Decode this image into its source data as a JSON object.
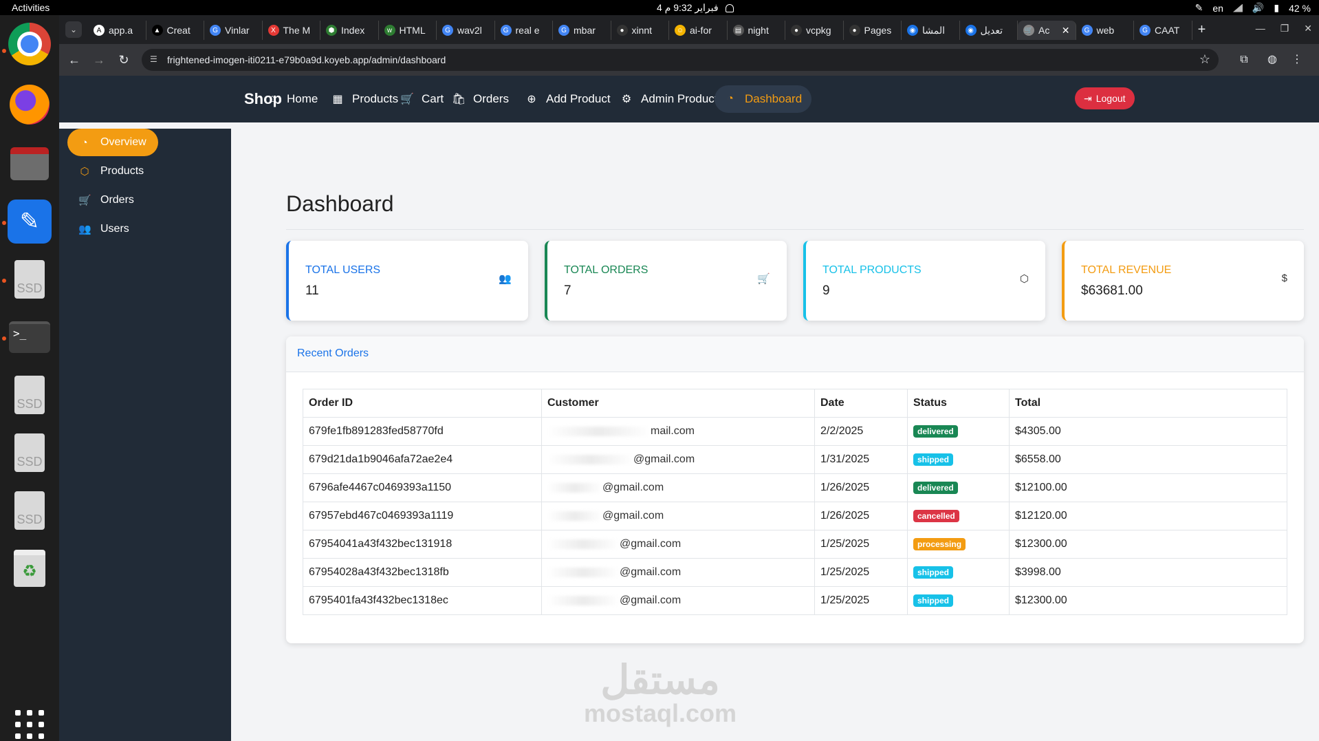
{
  "system": {
    "activities": "Activities",
    "clock": "4 فبراير  9:32 م",
    "lang": "en",
    "battery": "42 %"
  },
  "browser": {
    "tabs": [
      {
        "title": "app.a",
        "favicon_color": "#ffffff",
        "glyph": "A"
      },
      {
        "title": "Creat",
        "favicon_color": "#000000",
        "glyph": "▲"
      },
      {
        "title": "Vinlar",
        "favicon_color": "#4285f4",
        "glyph": "G"
      },
      {
        "title": "The M",
        "favicon_color": "#e53935",
        "glyph": "X"
      },
      {
        "title": "Index",
        "favicon_color": "#2e7d32",
        "glyph": "⬢"
      },
      {
        "title": "HTML",
        "favicon_color": "#2e7d32",
        "glyph": "w"
      },
      {
        "title": "wav2l",
        "favicon_color": "#4285f4",
        "glyph": "G"
      },
      {
        "title": "real e",
        "favicon_color": "#4285f4",
        "glyph": "G"
      },
      {
        "title": "mbar",
        "favicon_color": "#4285f4",
        "glyph": "G"
      },
      {
        "title": "xinnt",
        "favicon_color": "#333333",
        "glyph": "●"
      },
      {
        "title": "ai-for",
        "favicon_color": "#f4b400",
        "glyph": "☺"
      },
      {
        "title": "night",
        "favicon_color": "#555555",
        "glyph": "▤"
      },
      {
        "title": "vcpkg",
        "favicon_color": "#333333",
        "glyph": "●"
      },
      {
        "title": "Pages",
        "favicon_color": "#333333",
        "glyph": "●"
      },
      {
        "title": "المشا",
        "favicon_color": "#1a73e8",
        "glyph": "◉"
      },
      {
        "title": "تعديل",
        "favicon_color": "#1a73e8",
        "glyph": "◉"
      },
      {
        "title": "Ac",
        "favicon_color": "#888888",
        "glyph": "🛒"
      },
      {
        "title": "web",
        "favicon_color": "#4285f4",
        "glyph": "G"
      },
      {
        "title": "CAAT",
        "favicon_color": "#4285f4",
        "glyph": "G"
      }
    ],
    "active_tab_index": 16,
    "url": "frightened-imogen-iti0211-e79b0a9d.koyeb.app/admin/dashboard"
  },
  "navbar": {
    "brand": "Shop",
    "links": [
      {
        "label": "Home",
        "icon": "home-icon",
        "glyph": "⌂",
        "active": false
      },
      {
        "label": "Products",
        "icon": "grid-icon",
        "glyph": "▦",
        "active": false
      },
      {
        "label": "Cart",
        "icon": "cart-icon",
        "glyph": "🛒",
        "active": false
      },
      {
        "label": "Orders",
        "icon": "bag-icon",
        "glyph": "🛍",
        "active": false
      },
      {
        "label": "Add Product",
        "icon": "plus-circle-icon",
        "glyph": "⊕",
        "active": false
      },
      {
        "label": "Admin Products",
        "icon": "gear-icon",
        "glyph": "⚙",
        "active": false
      },
      {
        "label": "Dashboard",
        "icon": "speedometer-icon",
        "glyph": "◔",
        "active": true
      }
    ],
    "logout": "Logout",
    "accent": "#f39c12",
    "logout_color": "#dc2f40"
  },
  "sidebar": {
    "items": [
      {
        "label": "Overview",
        "icon": "speedometer-icon",
        "glyph": "◔",
        "active": true
      },
      {
        "label": "Products",
        "icon": "box-icon",
        "glyph": "⬡",
        "active": false
      },
      {
        "label": "Orders",
        "icon": "cart-icon",
        "glyph": "🛒",
        "active": false
      },
      {
        "label": "Users",
        "icon": "people-icon",
        "glyph": "👥",
        "active": false
      }
    ]
  },
  "main": {
    "title": "Dashboard",
    "stats": [
      {
        "label": "Total Users",
        "value": "11",
        "icon": "people-icon",
        "glyph": "👥",
        "color": "#1a73e8"
      },
      {
        "label": "Total Orders",
        "value": "7",
        "icon": "cart-icon",
        "glyph": "🛒",
        "color": "#198754"
      },
      {
        "label": "Total Products",
        "value": "9",
        "icon": "box-icon",
        "glyph": "⬡",
        "color": "#17c1e8"
      },
      {
        "label": "Total Revenue",
        "value": "$63681.00",
        "icon": "dollar-icon",
        "glyph": "$",
        "color": "#f39c12"
      }
    ],
    "recent_orders": {
      "title": "Recent Orders",
      "columns": [
        "Order ID",
        "Customer",
        "Date",
        "Status",
        "Total"
      ],
      "rows": [
        {
          "id": "679fe1fb891283fed58770fd",
          "customer": "mail.com",
          "date": "2/2/2025",
          "status": "delivered",
          "total": "$4305.00"
        },
        {
          "id": "679d21da1b9046afa72ae2e4",
          "customer": "@gmail.com",
          "date": "1/31/2025",
          "status": "shipped",
          "total": "$6558.00"
        },
        {
          "id": "6796afe4467c0469393a1150",
          "customer": "@gmail.com",
          "date": "1/26/2025",
          "status": "delivered",
          "total": "$12100.00"
        },
        {
          "id": "67957ebd467c0469393a1119",
          "customer": "@gmail.com",
          "date": "1/26/2025",
          "status": "cancelled",
          "total": "$12120.00"
        },
        {
          "id": "67954041a43f432bec131918",
          "customer": "@gmail.com",
          "date": "1/25/2025",
          "status": "processing",
          "total": "$12300.00"
        },
        {
          "id": "67954028a43f432bec1318fb",
          "customer": "@gmail.com",
          "date": "1/25/2025",
          "status": "shipped",
          "total": "$3998.00"
        },
        {
          "id": "6795401fa43f432bec1318ec",
          "customer": "@gmail.com",
          "date": "1/25/2025",
          "status": "shipped",
          "total": "$12300.00"
        }
      ],
      "status_colors": {
        "delivered": "#198754",
        "shipped": "#17c1e8",
        "cancelled": "#dc3545",
        "processing": "#f39c12"
      }
    }
  },
  "watermark": {
    "arabic": "مستقل",
    "latin": "mostaql.com"
  }
}
